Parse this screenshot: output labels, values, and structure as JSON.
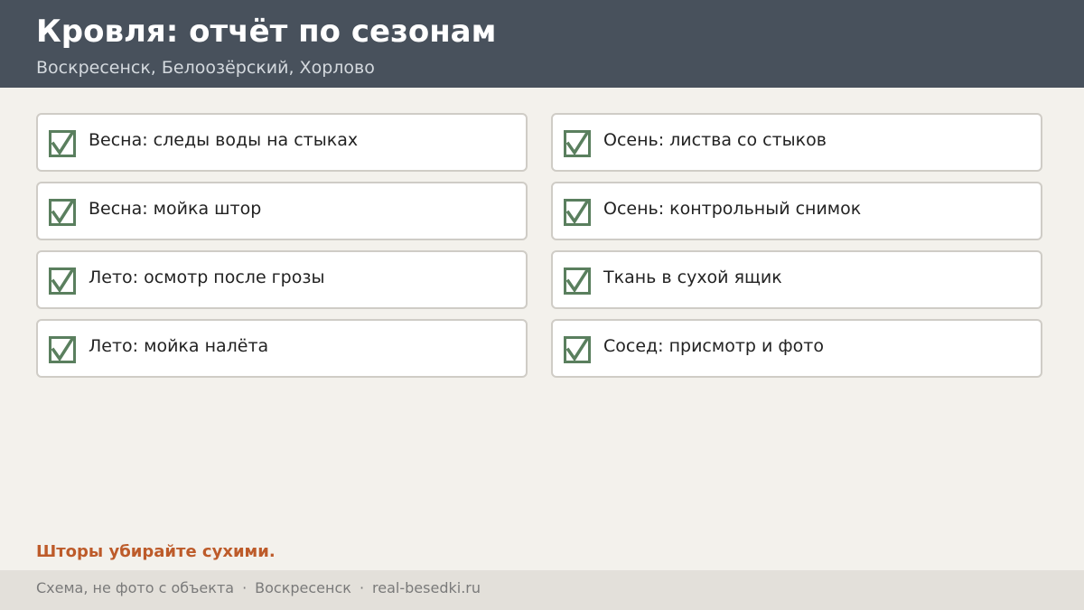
{
  "header": {
    "title": "Кровля: отчёт по сезонам",
    "subtitle": "Воскресенск, Белоозёрский, Хорлово"
  },
  "checklist": {
    "left": [
      {
        "label": "Весна: следы воды на стыках",
        "checked": true
      },
      {
        "label": "Весна: мойка штор",
        "checked": true
      },
      {
        "label": "Лето: осмотр после грозы",
        "checked": true
      },
      {
        "label": "Лето: мойка налёта",
        "checked": true
      }
    ],
    "right": [
      {
        "label": "Осень: листва со стыков",
        "checked": true
      },
      {
        "label": "Осень: контрольный снимок",
        "checked": true
      },
      {
        "label": "Ткань в сухой ящик",
        "checked": true
      },
      {
        "label": "Сосед: присмотр и фото",
        "checked": true
      }
    ]
  },
  "note": "Шторы убирайте сухими.",
  "footer": {
    "part1": "Схема, не фото с объекта",
    "part2": "Воскресенск",
    "part3": "real-besedki.ru",
    "separator": "·"
  },
  "colors": {
    "header_bg": "#48515c",
    "check": "#5a7f5e",
    "note": "#bd5b2a",
    "page_bg": "#f3f1ec"
  },
  "icons": {
    "check": "checkmark-icon"
  }
}
